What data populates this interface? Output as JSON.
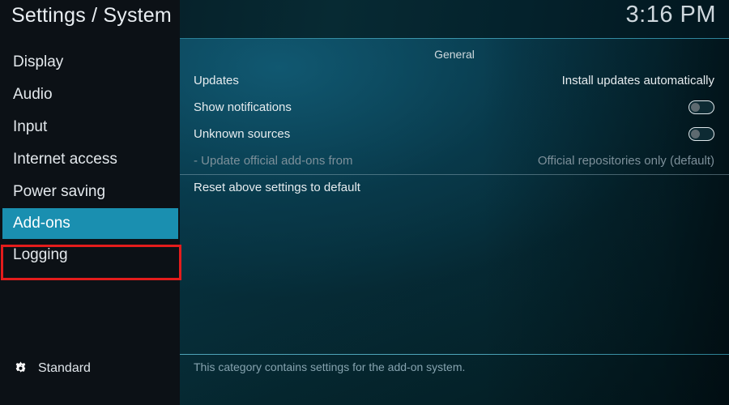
{
  "header": {
    "title": "Settings / System",
    "clock": "3:16 PM"
  },
  "sidebar": {
    "items": [
      {
        "label": "Display",
        "selected": false
      },
      {
        "label": "Audio",
        "selected": false
      },
      {
        "label": "Input",
        "selected": false
      },
      {
        "label": "Internet access",
        "selected": false
      },
      {
        "label": "Power saving",
        "selected": false
      },
      {
        "label": "Add-ons",
        "selected": true
      },
      {
        "label": "Logging",
        "selected": false
      }
    ],
    "profile": {
      "icon": "gear-icon",
      "label": "Standard"
    },
    "annotation_color": "#e41c1c",
    "highlight_color": "#1a8fb0"
  },
  "panel": {
    "section_title": "General",
    "rows": [
      {
        "label": "Updates",
        "value": "Install updates automatically",
        "type": "value",
        "disabled": false
      },
      {
        "label": "Show notifications",
        "value": "off",
        "type": "toggle",
        "disabled": false
      },
      {
        "label": "Unknown sources",
        "value": "off",
        "type": "toggle",
        "disabled": false
      },
      {
        "label": "- Update official add-ons from",
        "value": "Official repositories only (default)",
        "type": "value",
        "disabled": true
      },
      {
        "label": "Reset above settings to default",
        "value": "",
        "type": "action",
        "disabled": false
      }
    ],
    "footer_help": "This category contains settings for the add-on system."
  }
}
